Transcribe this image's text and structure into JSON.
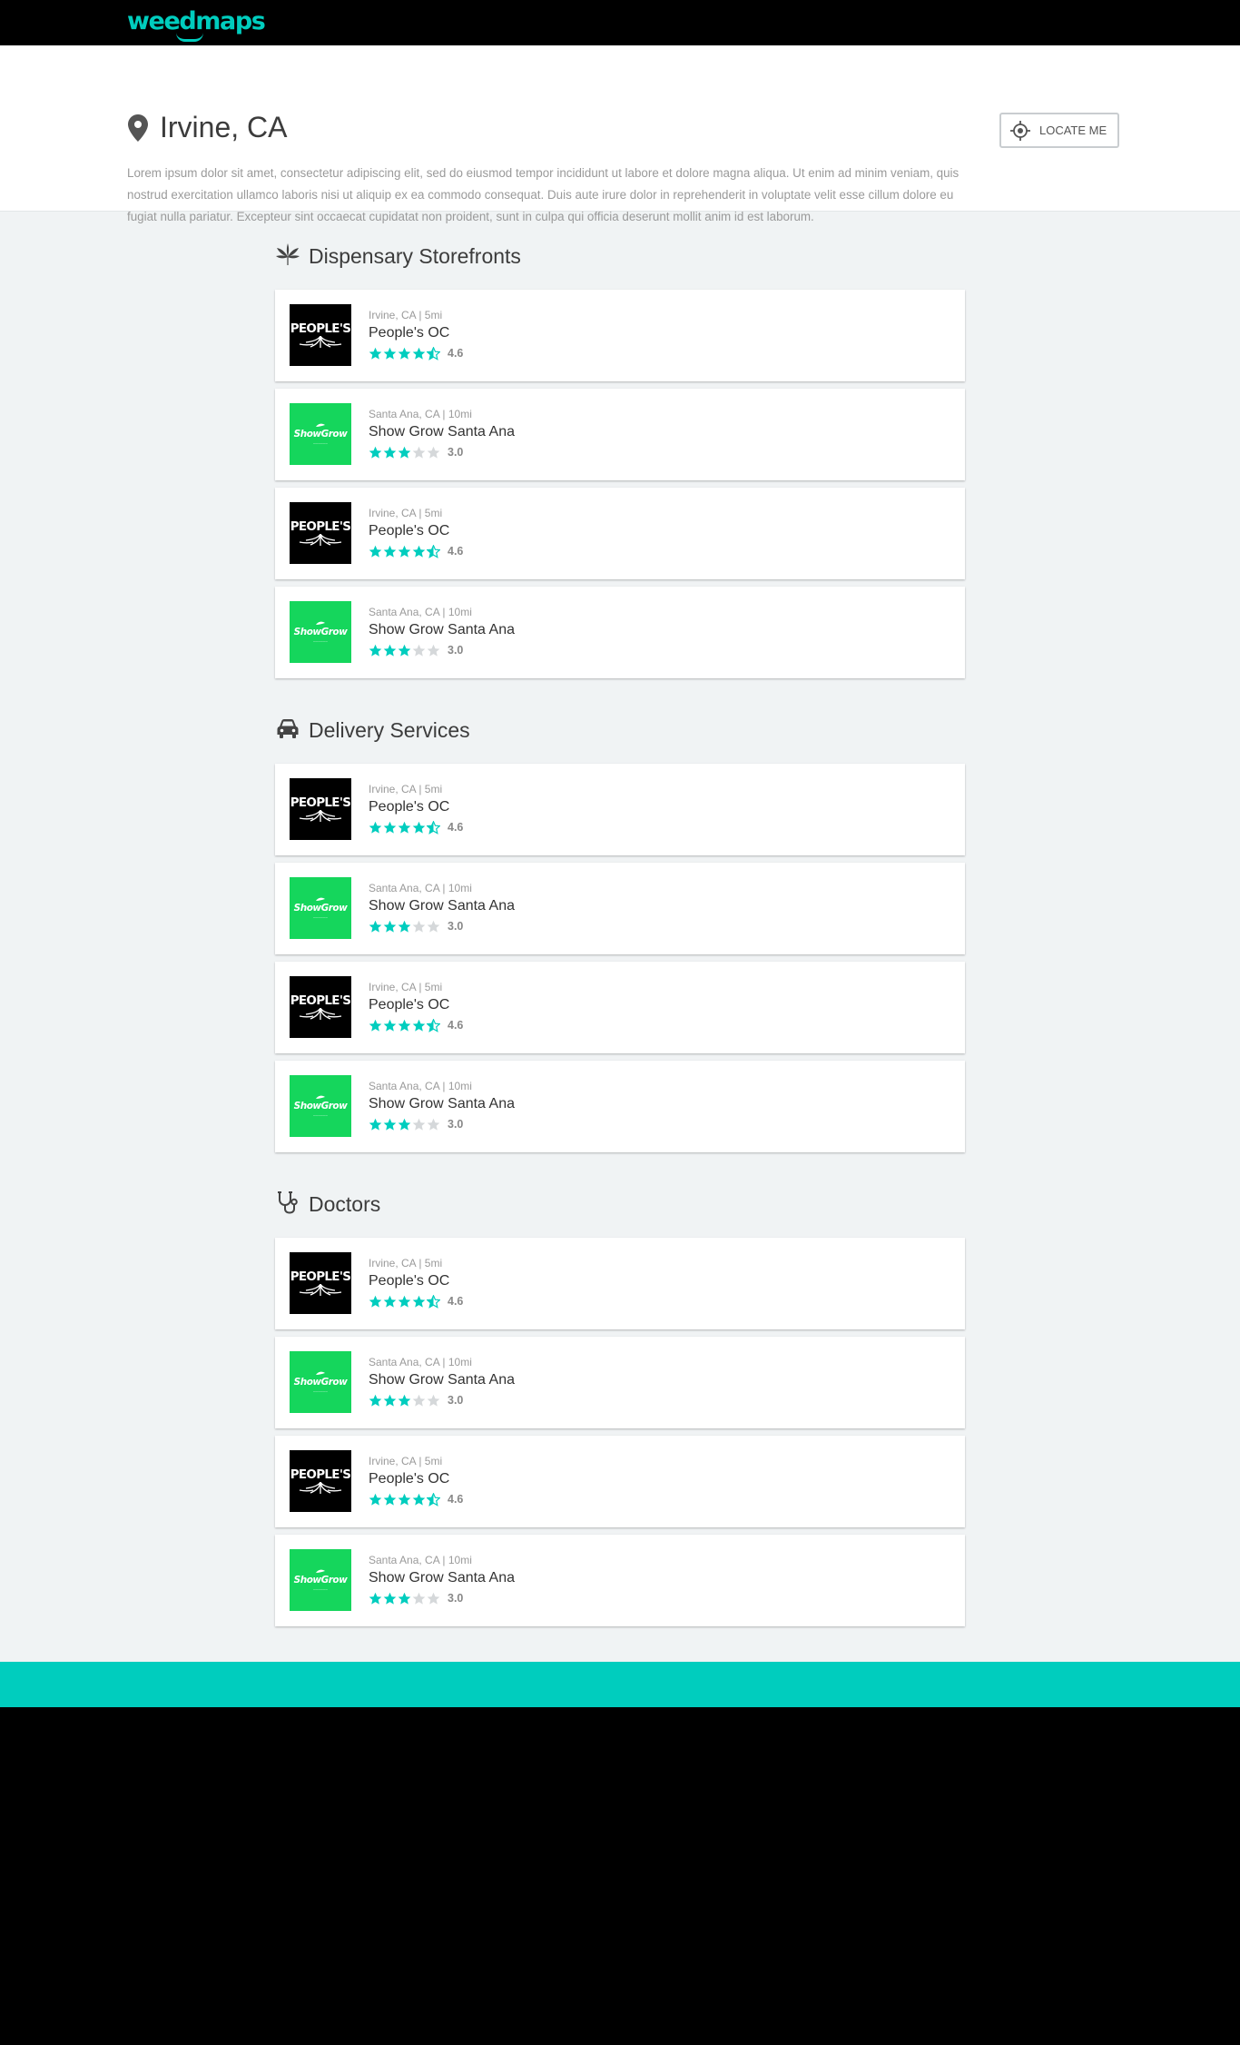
{
  "brand": {
    "name": "weedmaps",
    "accent": "#00cdbe"
  },
  "header": {
    "title": "Irvine, CA",
    "description": "Lorem ipsum dolor sit amet, consectetur adipiscing elit, sed do eiusmod tempor incididunt ut labore et dolore magna aliqua. Ut enim ad minim veniam, quis nostrud exercitation ullamco laboris nisi ut aliquip ex ea commodo consequat. Duis aute irure dolor in reprehenderit in voluptate velit esse cillum dolore eu fugiat nulla pariatur. Excepteur sint occaecat cupidatat non proident, sunt in culpa qui officia deserunt mollit anim id est laborum.",
    "locate_label": "LOCATE ME"
  },
  "sections": [
    {
      "title": "Dispensary Storefronts",
      "icon": "cannabis-leaf-icon",
      "listings": [
        {
          "meta": "Irvine, CA | 5mi",
          "name": "People's OC",
          "rating": 4.6,
          "rating_label": "4.6",
          "logo": "peoples",
          "logo_text": "PEOPLE'S"
        },
        {
          "meta": "Santa Ana, CA | 10mi",
          "name": "Show Grow Santa Ana",
          "rating": 3.0,
          "rating_label": "3.0",
          "logo": "showgrow",
          "logo_text": "ShowGrow"
        },
        {
          "meta": "Irvine, CA | 5mi",
          "name": "People's OC",
          "rating": 4.6,
          "rating_label": "4.6",
          "logo": "peoples",
          "logo_text": "PEOPLE'S"
        },
        {
          "meta": "Santa Ana, CA | 10mi",
          "name": "Show Grow Santa Ana",
          "rating": 3.0,
          "rating_label": "3.0",
          "logo": "showgrow",
          "logo_text": "ShowGrow"
        }
      ]
    },
    {
      "title": "Delivery Services",
      "icon": "car-icon",
      "listings": [
        {
          "meta": "Irvine, CA | 5mi",
          "name": "People's OC",
          "rating": 4.6,
          "rating_label": "4.6",
          "logo": "peoples",
          "logo_text": "PEOPLE'S"
        },
        {
          "meta": "Santa Ana, CA | 10mi",
          "name": "Show Grow Santa Ana",
          "rating": 3.0,
          "rating_label": "3.0",
          "logo": "showgrow",
          "logo_text": "ShowGrow"
        },
        {
          "meta": "Irvine, CA | 5mi",
          "name": "People's OC",
          "rating": 4.6,
          "rating_label": "4.6",
          "logo": "peoples",
          "logo_text": "PEOPLE'S"
        },
        {
          "meta": "Santa Ana, CA | 10mi",
          "name": "Show Grow Santa Ana",
          "rating": 3.0,
          "rating_label": "3.0",
          "logo": "showgrow",
          "logo_text": "ShowGrow"
        }
      ]
    },
    {
      "title": "Doctors",
      "icon": "stethoscope-icon",
      "listings": [
        {
          "meta": "Irvine, CA | 5mi",
          "name": "People's OC",
          "rating": 4.6,
          "rating_label": "4.6",
          "logo": "peoples",
          "logo_text": "PEOPLE'S"
        },
        {
          "meta": "Santa Ana, CA | 10mi",
          "name": "Show Grow Santa Ana",
          "rating": 3.0,
          "rating_label": "3.0",
          "logo": "showgrow",
          "logo_text": "ShowGrow"
        },
        {
          "meta": "Irvine, CA | 5mi",
          "name": "People's OC",
          "rating": 4.6,
          "rating_label": "4.6",
          "logo": "peoples",
          "logo_text": "PEOPLE'S"
        },
        {
          "meta": "Santa Ana, CA | 10mi",
          "name": "Show Grow Santa Ana",
          "rating": 3.0,
          "rating_label": "3.0",
          "logo": "showgrow",
          "logo_text": "ShowGrow"
        }
      ]
    }
  ],
  "colors": {
    "star_filled": "#00cdbe",
    "star_empty": "#d5d8da",
    "footer": "#00cdbe"
  }
}
